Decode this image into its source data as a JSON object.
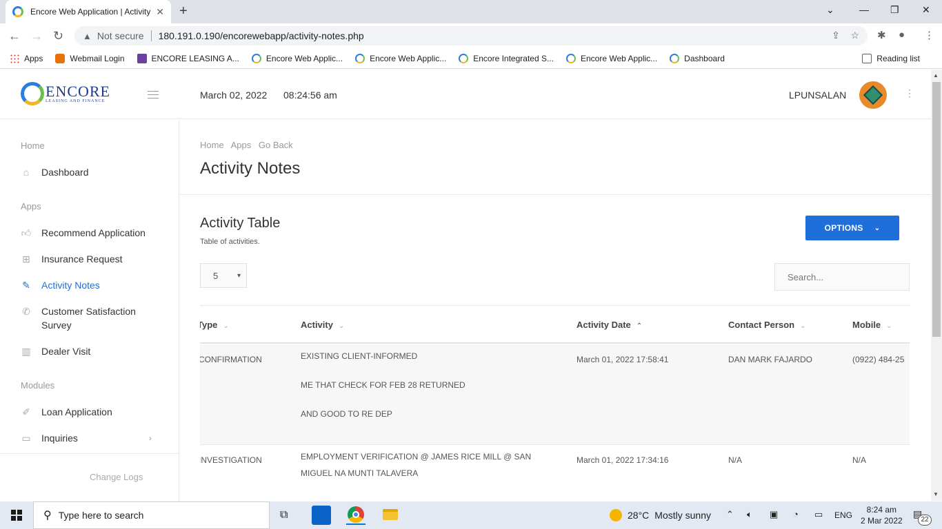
{
  "browser": {
    "tab_title": "Encore Web Application | Activity Notes",
    "not_secure": "Not secure",
    "url": "180.191.0.190/encorewebapp/activity-notes.php",
    "bookmarks": [
      {
        "label": "Apps",
        "icon": "apps-grid-icon"
      },
      {
        "label": "Webmail Login",
        "icon": "webmail-icon"
      },
      {
        "label": "ENCORE LEASING A...",
        "icon": "list-icon"
      },
      {
        "label": "Encore Web Applic...",
        "icon": "encore-icon"
      },
      {
        "label": "Encore Web Applic...",
        "icon": "encore-icon"
      },
      {
        "label": "Encore Integrated S...",
        "icon": "encore-icon"
      },
      {
        "label": "Encore Web Applic...",
        "icon": "encore-icon"
      },
      {
        "label": "Dashboard",
        "icon": "encore-icon"
      }
    ],
    "reading_list": "Reading list"
  },
  "header": {
    "logo_main": "ENCORE",
    "logo_sub": "LEASING AND FINANCE",
    "date": "March 02, 2022",
    "time": "08:24:56 am",
    "username": "LPUNSALAN"
  },
  "sidebar": {
    "section_home": "Home",
    "dashboard": "Dashboard",
    "section_apps": "Apps",
    "recommend": "Recommend Application",
    "insurance": "Insurance Request",
    "activity": "Activity Notes",
    "survey": "Customer Satisfaction Survey",
    "dealer": "Dealer Visit",
    "section_modules": "Modules",
    "loan": "Loan Application",
    "inquiries": "Inquiries",
    "changelogs": "Change Logs"
  },
  "main": {
    "breadcrumbs": [
      "Home",
      "Apps",
      "Go Back"
    ],
    "title": "Activity Notes",
    "card_title": "Activity Table",
    "card_sub": "Table of activities.",
    "options_label": "OPTIONS",
    "page_size": "5",
    "search_placeholder": "Search..."
  },
  "table": {
    "columns": [
      "Type",
      "Activity",
      "Activity Date",
      "Contact Person",
      "Mobile"
    ],
    "rows": [
      {
        "type": "CONFIRMATION",
        "activity": [
          "EXISTING CLIENT-INFORMED",
          "ME THAT CHECK FOR FEB 28 RETURNED",
          "AND GOOD TO RE DEP"
        ],
        "date": "March 01, 2022 17:58:41",
        "contact": "DAN MARK FAJARDO",
        "mobile": "(0922) 484-25"
      },
      {
        "type": "INVESTIGATION",
        "activity": [
          "EMPLOYMENT VERIFICATION @ JAMES RICE MILL @ SAN MIGUEL NA MUNTI TALAVERA"
        ],
        "date": "March 01, 2022 17:34:16",
        "contact": "N/A",
        "mobile": "N/A"
      }
    ]
  },
  "taskbar": {
    "search_placeholder": "Type here to search",
    "weather_temp": "28°C",
    "weather_desc": "Mostly sunny",
    "lang": "ENG",
    "time": "8:24 am",
    "date": "2 Mar 2022",
    "notifications": "22"
  },
  "colors": {
    "accent": "#1e6fd9",
    "avatar_bg": "#e8892b"
  }
}
